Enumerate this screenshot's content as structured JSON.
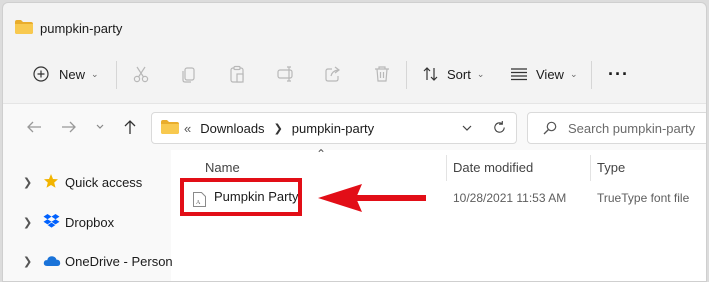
{
  "window": {
    "title": "pumpkin-party"
  },
  "toolbar": {
    "new_label": "New",
    "sort_label": "Sort",
    "view_label": "View",
    "more_label": "···"
  },
  "address": {
    "overflow": "«",
    "crumbs": [
      "Downloads",
      "pumpkin-party"
    ],
    "search_placeholder": "Search pumpkin-party"
  },
  "sidebar": {
    "items": [
      {
        "label": "Quick access",
        "icon": "star-icon"
      },
      {
        "label": "Dropbox",
        "icon": "dropbox-icon"
      },
      {
        "label": "OneDrive - Personal",
        "icon": "cloud-icon"
      }
    ]
  },
  "columns": {
    "name": "Name",
    "date": "Date modified",
    "type": "Type"
  },
  "files": [
    {
      "name": "Pumpkin Party",
      "date": "10/28/2021 11:53 AM",
      "type": "TrueType font file",
      "icon": "font-file-icon"
    }
  ],
  "colors": {
    "accent": "#e20e17",
    "folder": "#f5c04a"
  }
}
